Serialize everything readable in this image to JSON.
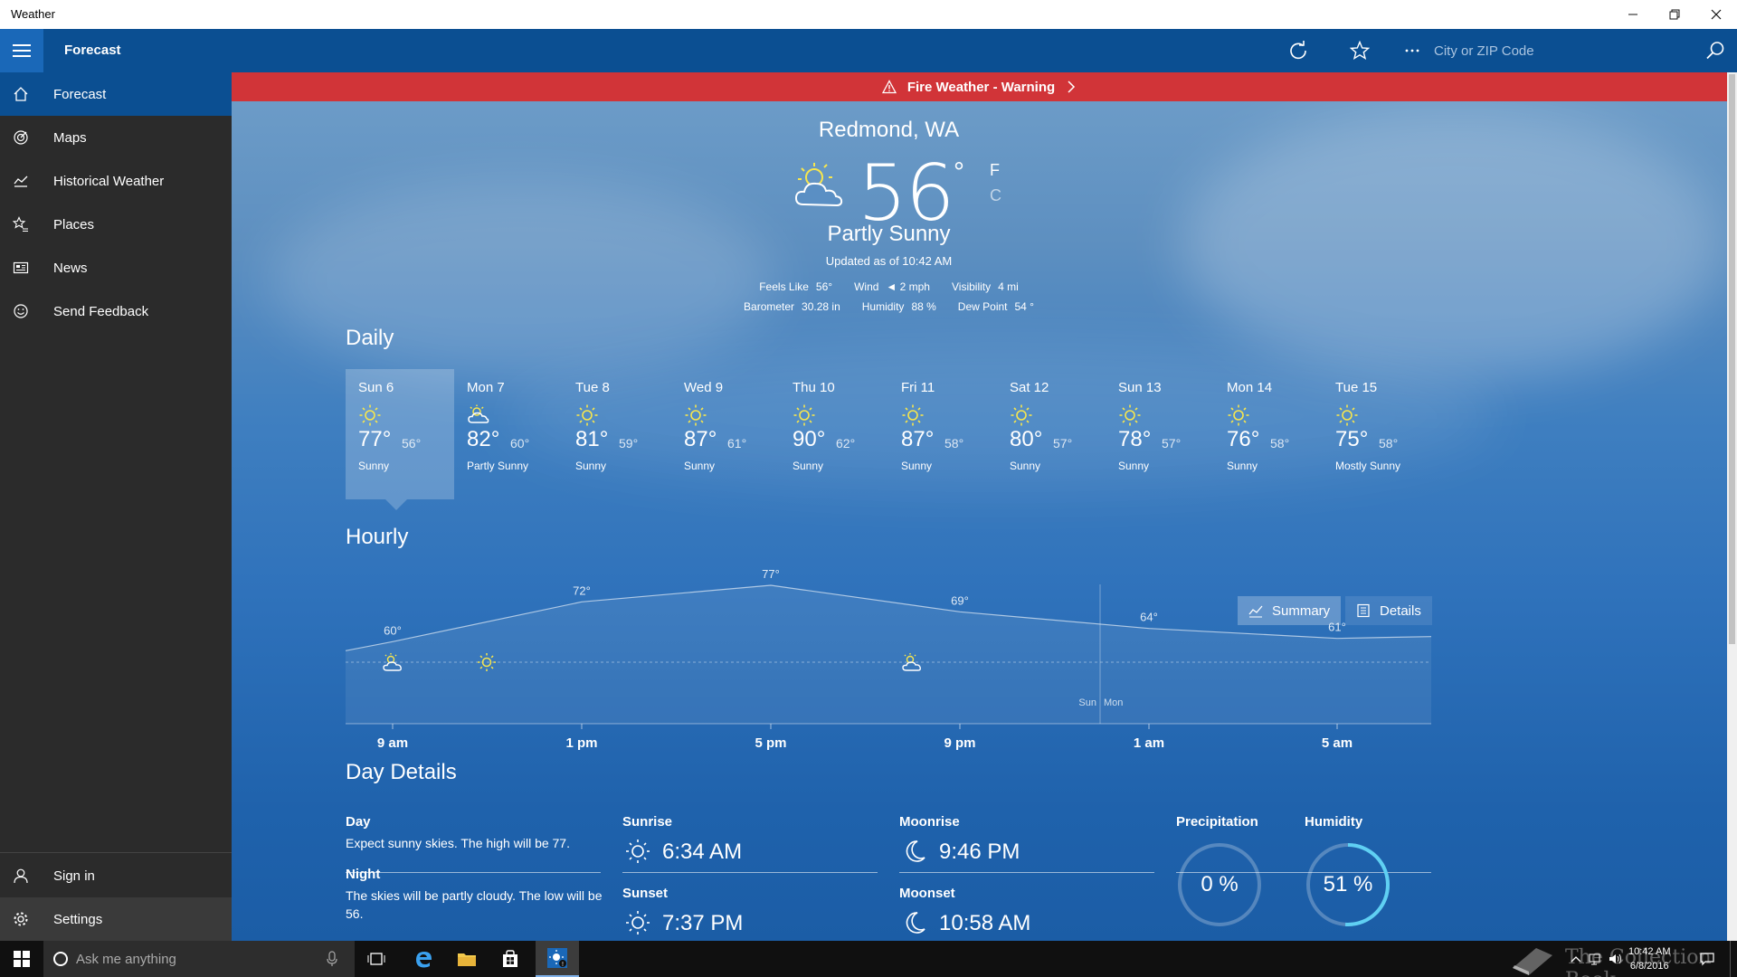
{
  "window": {
    "title": "Weather"
  },
  "header": {
    "page_title": "Forecast",
    "search_placeholder": "City or ZIP Code"
  },
  "sidebar": {
    "items": [
      {
        "label": "Forecast",
        "icon": "home-icon"
      },
      {
        "label": "Maps",
        "icon": "radar-icon"
      },
      {
        "label": "Historical Weather",
        "icon": "chart-icon"
      },
      {
        "label": "Places",
        "icon": "star-list-icon"
      },
      {
        "label": "News",
        "icon": "news-icon"
      },
      {
        "label": "Send Feedback",
        "icon": "smiley-icon"
      }
    ],
    "bottom": [
      {
        "label": "Sign in",
        "icon": "person-icon"
      },
      {
        "label": "Settings",
        "icon": "gear-icon"
      }
    ]
  },
  "banner": {
    "text": "Fire Weather - Warning"
  },
  "current": {
    "location": "Redmond, WA",
    "temperature": "56",
    "degree": "°",
    "unit_f": "F",
    "unit_c": "C",
    "condition": "Partly Sunny",
    "updated": "Updated as of 10:42 AM",
    "stats_row1": [
      {
        "label": "Feels Like",
        "value": "56°"
      },
      {
        "label": "Wind",
        "value": "◄ 2 mph"
      },
      {
        "label": "Visibility",
        "value": "4 mi"
      }
    ],
    "stats_row2": [
      {
        "label": "Barometer",
        "value": "30.28 in"
      },
      {
        "label": "Humidity",
        "value": "88 %"
      },
      {
        "label": "Dew Point",
        "value": "54 °"
      }
    ]
  },
  "daily": {
    "title": "Daily",
    "days": [
      {
        "name": "Sun 6",
        "hi": "77°",
        "lo": "56°",
        "cond": "Sunny",
        "icon": "sun-icon"
      },
      {
        "name": "Mon 7",
        "hi": "82°",
        "lo": "60°",
        "cond": "Partly Sunny",
        "icon": "partly-sunny-icon"
      },
      {
        "name": "Tue 8",
        "hi": "81°",
        "lo": "59°",
        "cond": "Sunny",
        "icon": "sun-icon"
      },
      {
        "name": "Wed 9",
        "hi": "87°",
        "lo": "61°",
        "cond": "Sunny",
        "icon": "sun-icon"
      },
      {
        "name": "Thu 10",
        "hi": "90°",
        "lo": "62°",
        "cond": "Sunny",
        "icon": "sun-icon"
      },
      {
        "name": "Fri 11",
        "hi": "87°",
        "lo": "58°",
        "cond": "Sunny",
        "icon": "sun-icon"
      },
      {
        "name": "Sat 12",
        "hi": "80°",
        "lo": "57°",
        "cond": "Sunny",
        "icon": "sun-icon"
      },
      {
        "name": "Sun 13",
        "hi": "78°",
        "lo": "57°",
        "cond": "Sunny",
        "icon": "sun-icon"
      },
      {
        "name": "Mon 14",
        "hi": "76°",
        "lo": "58°",
        "cond": "Sunny",
        "icon": "sun-icon"
      },
      {
        "name": "Tue 15",
        "hi": "75°",
        "lo": "58°",
        "cond": "Mostly Sunny",
        "icon": "sun-icon"
      }
    ]
  },
  "hourly": {
    "title": "Hourly",
    "summary_label": "Summary",
    "details_label": "Details",
    "day_divider": [
      "Sun",
      "Mon"
    ],
    "icons": [
      "partly-sunny-icon",
      "sun-icon",
      "partly-cloudy-night-icon"
    ]
  },
  "chart_data": {
    "type": "line",
    "x": [
      "9 am",
      "1 pm",
      "5 pm",
      "9 pm",
      "1 am",
      "5 am"
    ],
    "series": [
      {
        "values": [
          60,
          72,
          77,
          69,
          64,
          61
        ]
      }
    ],
    "data_labels": [
      "60°",
      "72°",
      "77°",
      "69°",
      "64°",
      "61°"
    ],
    "xlabel": "",
    "ylabel": ""
  },
  "day_details": {
    "title": "Day Details",
    "day_label": "Day",
    "day_text": "Expect sunny skies. The high will be 77.",
    "night_label": "Night",
    "night_text": "The skies will be partly cloudy. The low will be 56.",
    "sunrise_label": "Sunrise",
    "sunrise": "6:34 AM",
    "sunset_label": "Sunset",
    "sunset": "7:37 PM",
    "moonrise_label": "Moonrise",
    "moonrise": "9:46 PM",
    "moonset_label": "Moonset",
    "moonset": "10:58 AM",
    "precip_label": "Precipitation",
    "precip": "0 %",
    "precip_fraction": 0,
    "humidity_label": "Humidity",
    "humidity": "51 %",
    "humidity_fraction": 0.51
  },
  "taskbar": {
    "search_placeholder": "Ask me anything",
    "time": "10:42 AM",
    "date": "6/8/2016",
    "watermark": "The Collection Book"
  },
  "colors": {
    "accent": "#0b4f92",
    "banner": "#d13438",
    "sun": "#f7e64d",
    "ring": "#5fd0f3"
  }
}
